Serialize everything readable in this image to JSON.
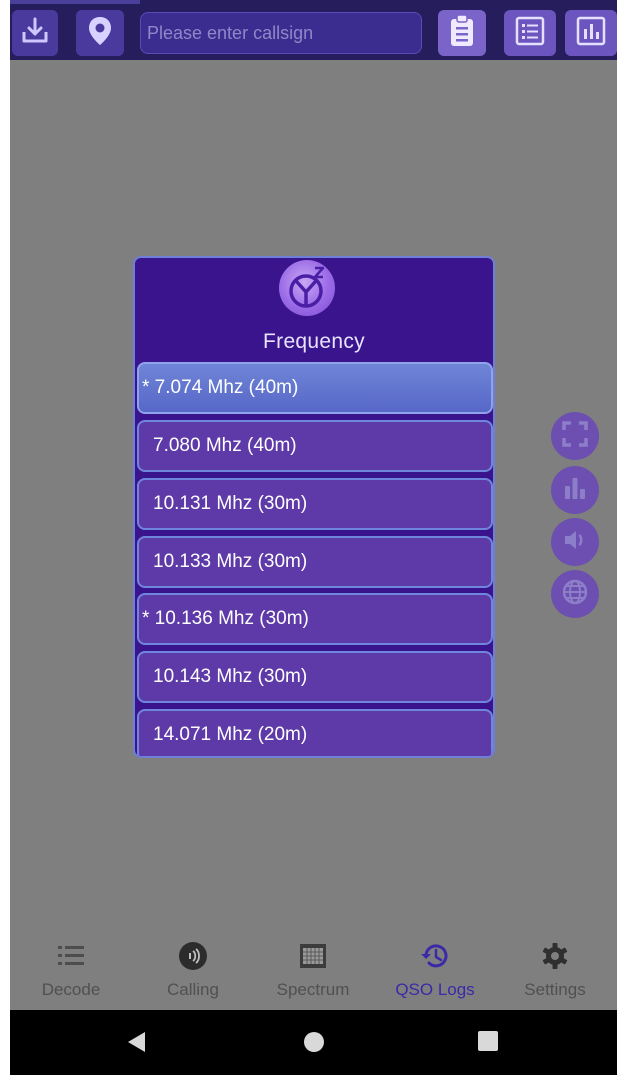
{
  "topbar": {
    "callsign_placeholder": "Please enter callsign",
    "icons": [
      "download-icon",
      "location-pin-icon",
      "clipboard-icon",
      "list-icon",
      "bar-chart-icon"
    ]
  },
  "dialog": {
    "title": "Frequency",
    "logo": "app-logo",
    "items": [
      {
        "label": "* 7.074 Mhz (40m)",
        "selected": true
      },
      {
        "label": "7.080 Mhz (40m)",
        "selected": false
      },
      {
        "label": "10.131 Mhz (30m)",
        "selected": false
      },
      {
        "label": "10.133 Mhz (30m)",
        "selected": false
      },
      {
        "label": "* 10.136 Mhz (30m)",
        "selected": false
      },
      {
        "label": "10.143 Mhz (30m)",
        "selected": false
      },
      {
        "label": "14.071 Mhz (20m)",
        "selected": false
      }
    ]
  },
  "side_buttons": [
    "fullscreen-icon",
    "bar-chart-icon",
    "speaker-icon",
    "globe-icon"
  ],
  "bottom_nav": {
    "items": [
      {
        "label": "Decode",
        "icon": "list-icon",
        "active": false
      },
      {
        "label": "Calling",
        "icon": "calling-icon",
        "active": false
      },
      {
        "label": "Spectrum",
        "icon": "spectrum-icon",
        "active": false
      },
      {
        "label": "QSO Logs",
        "icon": "history-icon",
        "active": true
      },
      {
        "label": "Settings",
        "icon": "gear-icon",
        "active": false
      }
    ]
  },
  "colors": {
    "topbar_bg": "#261d5c",
    "dialog_bg": "#3a148c",
    "item_bg": "#5d3aa7",
    "selected_item_bg": "#6f85d6",
    "active_nav": "#3a2aa8",
    "screen_dim": "#7f7f7f"
  }
}
